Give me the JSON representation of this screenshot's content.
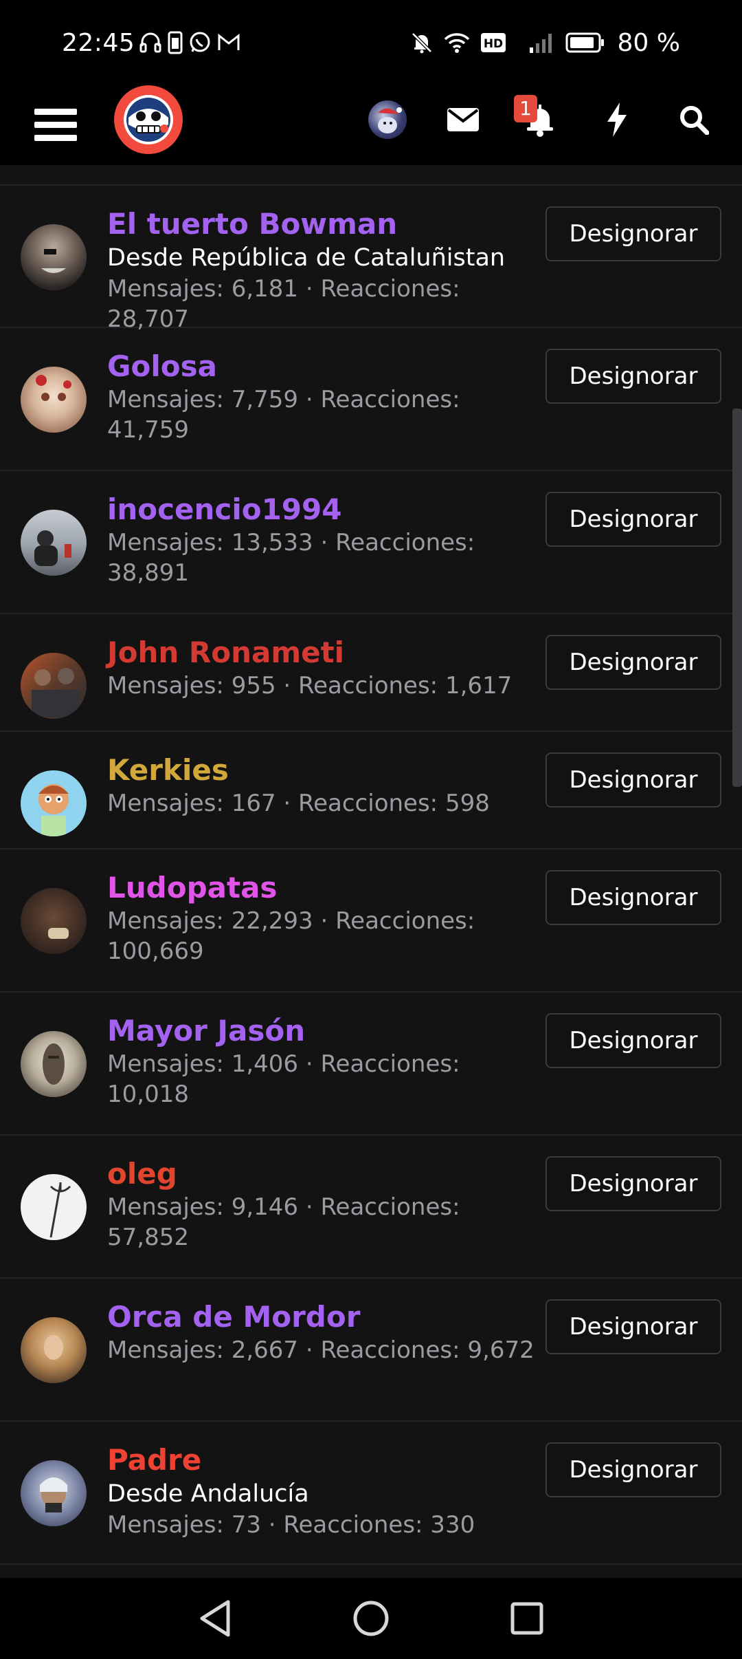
{
  "status_bar": {
    "time": "22:45",
    "battery_pct": "80 %",
    "left_icons": [
      "headphones-icon",
      "phone-icon",
      "whatsapp-icon",
      "gmail-icon"
    ],
    "right_icons": [
      "bell-muted-icon",
      "wifi-icon",
      "hd-icon",
      "signal-icon",
      "battery-icon"
    ]
  },
  "header": {
    "notification_count": "1",
    "icons": [
      "hamburger-menu-icon",
      "site-logo",
      "user-avatar",
      "mail-icon",
      "bell-icon",
      "bolt-icon",
      "search-icon"
    ]
  },
  "members": [
    {
      "name": "El tuerto Bowman",
      "name_color": "#a462f0",
      "location": "Desde República de Cataluñistan",
      "stats": "Mensajes: 6,181 · Reacciones: 28,707",
      "button": "Designorar"
    },
    {
      "name": "Golosa",
      "name_color": "#a462f0",
      "location": "",
      "stats": "Mensajes: 7,759 · Reacciones: 41,759",
      "button": "Designorar"
    },
    {
      "name": "inocencio1994",
      "name_color": "#a462f0",
      "location": "",
      "stats": "Mensajes: 13,533 · Reacciones: 38,891",
      "button": "Designorar"
    },
    {
      "name": "John Ronameti",
      "name_color": "#d23a33",
      "location": "",
      "stats": "Mensajes: 955 · Reacciones: 1,617",
      "button": "Designorar"
    },
    {
      "name": "Kerkies",
      "name_color": "#d3a83a",
      "location": "",
      "stats": "Mensajes: 167 · Reacciones: 598",
      "button": "Designorar"
    },
    {
      "name": "Ludopatas",
      "name_color": "#e054e8",
      "location": "",
      "stats": "Mensajes: 22,293 · Reacciones: 100,669",
      "button": "Designorar"
    },
    {
      "name": "Mayor Jasón",
      "name_color": "#a462f0",
      "location": "",
      "stats": "Mensajes: 1,406 · Reacciones: 10,018",
      "button": "Designorar"
    },
    {
      "name": "oleg",
      "name_color": "#e2452e",
      "location": "",
      "stats": "Mensajes: 9,146 · Reacciones: 57,852",
      "button": "Designorar"
    },
    {
      "name": "Orca de Mordor",
      "name_color": "#a462f0",
      "location": "",
      "stats": "Mensajes: 2,667 · Reacciones: 9,672",
      "button": "Designorar"
    },
    {
      "name": "Padre",
      "name_color": "#ef4233",
      "location": "Desde Andalucía",
      "stats": "Mensajes: 73 · Reacciones: 330",
      "button": "Designorar"
    }
  ],
  "nav": {
    "icons": [
      "back-icon",
      "home-icon",
      "recents-icon"
    ]
  }
}
